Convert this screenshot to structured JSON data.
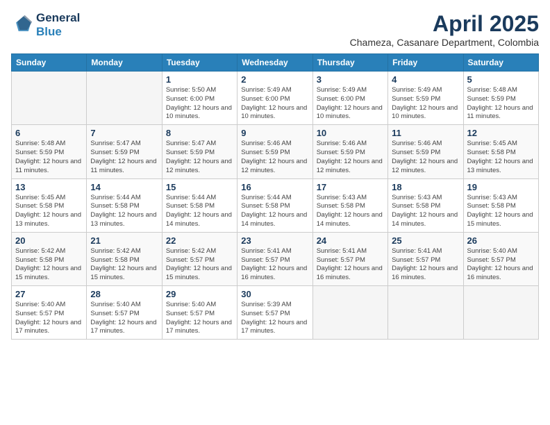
{
  "header": {
    "logo_line1": "General",
    "logo_line2": "Blue",
    "month_year": "April 2025",
    "location": "Chameza, Casanare Department, Colombia"
  },
  "weekdays": [
    "Sunday",
    "Monday",
    "Tuesday",
    "Wednesday",
    "Thursday",
    "Friday",
    "Saturday"
  ],
  "weeks": [
    [
      {
        "day": "",
        "empty": true
      },
      {
        "day": "",
        "empty": true
      },
      {
        "day": "1",
        "sunrise": "5:50 AM",
        "sunset": "6:00 PM",
        "daylight": "12 hours and 10 minutes."
      },
      {
        "day": "2",
        "sunrise": "5:49 AM",
        "sunset": "6:00 PM",
        "daylight": "12 hours and 10 minutes."
      },
      {
        "day": "3",
        "sunrise": "5:49 AM",
        "sunset": "6:00 PM",
        "daylight": "12 hours and 10 minutes."
      },
      {
        "day": "4",
        "sunrise": "5:49 AM",
        "sunset": "5:59 PM",
        "daylight": "12 hours and 10 minutes."
      },
      {
        "day": "5",
        "sunrise": "5:48 AM",
        "sunset": "5:59 PM",
        "daylight": "12 hours and 11 minutes."
      }
    ],
    [
      {
        "day": "6",
        "sunrise": "5:48 AM",
        "sunset": "5:59 PM",
        "daylight": "12 hours and 11 minutes."
      },
      {
        "day": "7",
        "sunrise": "5:47 AM",
        "sunset": "5:59 PM",
        "daylight": "12 hours and 11 minutes."
      },
      {
        "day": "8",
        "sunrise": "5:47 AM",
        "sunset": "5:59 PM",
        "daylight": "12 hours and 12 minutes."
      },
      {
        "day": "9",
        "sunrise": "5:46 AM",
        "sunset": "5:59 PM",
        "daylight": "12 hours and 12 minutes."
      },
      {
        "day": "10",
        "sunrise": "5:46 AM",
        "sunset": "5:59 PM",
        "daylight": "12 hours and 12 minutes."
      },
      {
        "day": "11",
        "sunrise": "5:46 AM",
        "sunset": "5:59 PM",
        "daylight": "12 hours and 12 minutes."
      },
      {
        "day": "12",
        "sunrise": "5:45 AM",
        "sunset": "5:58 PM",
        "daylight": "12 hours and 13 minutes."
      }
    ],
    [
      {
        "day": "13",
        "sunrise": "5:45 AM",
        "sunset": "5:58 PM",
        "daylight": "12 hours and 13 minutes."
      },
      {
        "day": "14",
        "sunrise": "5:44 AM",
        "sunset": "5:58 PM",
        "daylight": "12 hours and 13 minutes."
      },
      {
        "day": "15",
        "sunrise": "5:44 AM",
        "sunset": "5:58 PM",
        "daylight": "12 hours and 14 minutes."
      },
      {
        "day": "16",
        "sunrise": "5:44 AM",
        "sunset": "5:58 PM",
        "daylight": "12 hours and 14 minutes."
      },
      {
        "day": "17",
        "sunrise": "5:43 AM",
        "sunset": "5:58 PM",
        "daylight": "12 hours and 14 minutes."
      },
      {
        "day": "18",
        "sunrise": "5:43 AM",
        "sunset": "5:58 PM",
        "daylight": "12 hours and 14 minutes."
      },
      {
        "day": "19",
        "sunrise": "5:43 AM",
        "sunset": "5:58 PM",
        "daylight": "12 hours and 15 minutes."
      }
    ],
    [
      {
        "day": "20",
        "sunrise": "5:42 AM",
        "sunset": "5:58 PM",
        "daylight": "12 hours and 15 minutes."
      },
      {
        "day": "21",
        "sunrise": "5:42 AM",
        "sunset": "5:58 PM",
        "daylight": "12 hours and 15 minutes."
      },
      {
        "day": "22",
        "sunrise": "5:42 AM",
        "sunset": "5:57 PM",
        "daylight": "12 hours and 15 minutes."
      },
      {
        "day": "23",
        "sunrise": "5:41 AM",
        "sunset": "5:57 PM",
        "daylight": "12 hours and 16 minutes."
      },
      {
        "day": "24",
        "sunrise": "5:41 AM",
        "sunset": "5:57 PM",
        "daylight": "12 hours and 16 minutes."
      },
      {
        "day": "25",
        "sunrise": "5:41 AM",
        "sunset": "5:57 PM",
        "daylight": "12 hours and 16 minutes."
      },
      {
        "day": "26",
        "sunrise": "5:40 AM",
        "sunset": "5:57 PM",
        "daylight": "12 hours and 16 minutes."
      }
    ],
    [
      {
        "day": "27",
        "sunrise": "5:40 AM",
        "sunset": "5:57 PM",
        "daylight": "12 hours and 17 minutes."
      },
      {
        "day": "28",
        "sunrise": "5:40 AM",
        "sunset": "5:57 PM",
        "daylight": "12 hours and 17 minutes."
      },
      {
        "day": "29",
        "sunrise": "5:40 AM",
        "sunset": "5:57 PM",
        "daylight": "12 hours and 17 minutes."
      },
      {
        "day": "30",
        "sunrise": "5:39 AM",
        "sunset": "5:57 PM",
        "daylight": "12 hours and 17 minutes."
      },
      {
        "day": "",
        "empty": true
      },
      {
        "day": "",
        "empty": true
      },
      {
        "day": "",
        "empty": true
      }
    ]
  ]
}
